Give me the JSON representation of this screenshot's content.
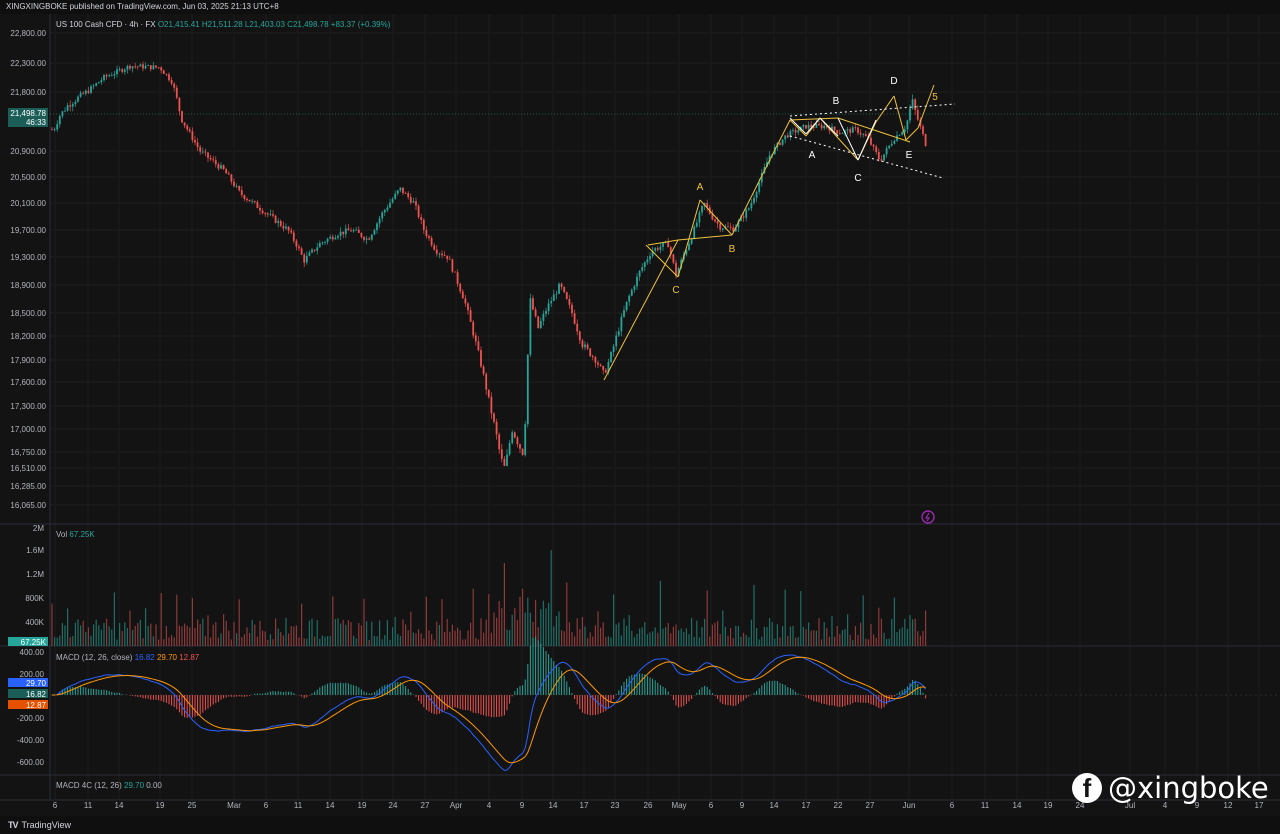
{
  "header": {
    "publisher": "XINGXINGBOKE published on TradingView.com, Jun 03, 2025 21:13 UTC+8"
  },
  "legend": {
    "main": {
      "symbol": "US 100 Cash CFD · 4h · FX",
      "open": "O21,415.41",
      "high": "H21,511.28",
      "low": "L21,403.03",
      "close": "C21,498.78",
      "change": "+83.37 (+0.39%)"
    },
    "volume": {
      "label": "Vol",
      "value": "67.25K"
    },
    "macd": {
      "label": "MACD (12, 26, close)",
      "v1": "16.82",
      "v2": "29.70",
      "v3": "12.87"
    },
    "macd4c": {
      "label": "MACD 4C (12, 26)",
      "v1": "29.70",
      "v2": "0.00"
    }
  },
  "footer": {
    "brand": "TradingView",
    "watermark": "@xingboke",
    "watermark_icon": "facebook-icon"
  },
  "colors": {
    "up": "#26a69a",
    "down": "#ef5350",
    "wave": "#f0c23b",
    "macd": "#2962ff",
    "signal": "#ff9800",
    "bg": "#131313"
  },
  "chart_data": {
    "type": "candlestick",
    "price_axis": {
      "ticks": [
        "22,800.00",
        "22,300.00",
        "21,800.00",
        "21,498.78",
        "20,900.00",
        "20,500.00",
        "20,100.00",
        "19,700.00",
        "19,300.00",
        "18,900.00",
        "18,500.00",
        "18,200.00",
        "17,900.00",
        "17,600.00",
        "17,300.00",
        "17,000.00",
        "16,750.00",
        "16,510.00",
        "16,285.00",
        "16,065.00"
      ],
      "current_price": "21,498.78",
      "countdown": "46:33",
      "ylim": [
        16065,
        22800
      ]
    },
    "time_axis": {
      "labels": [
        "6",
        "11",
        "14",
        "19",
        "25",
        "Mar",
        "6",
        "11",
        "14",
        "19",
        "24",
        "27",
        "Apr",
        "4",
        "9",
        "14",
        "17",
        "23",
        "26",
        "May",
        "6",
        "9",
        "14",
        "17",
        "22",
        "27",
        "Jun",
        "6",
        "11",
        "14",
        "19",
        "24",
        "Jul",
        "4",
        "9",
        "12",
        "17"
      ]
    },
    "price_path": [
      [
        "Feb 6",
        21250
      ],
      [
        "Feb 8",
        21480
      ],
      [
        "Feb 11",
        21620
      ],
      [
        "Feb 14",
        21820
      ],
      [
        "Feb 17",
        22050
      ],
      [
        "Feb 19",
        22250
      ],
      [
        "Feb 20",
        22222
      ],
      [
        "Feb 21",
        21980
      ],
      [
        "Feb 24",
        21400
      ],
      [
        "Feb 27",
        20900
      ],
      [
        "Mar 3",
        20600
      ],
      [
        "Mar 6",
        20250
      ],
      [
        "Mar 10",
        19700
      ],
      [
        "Mar 11",
        19500
      ],
      [
        "Mar 13",
        19250
      ],
      [
        "Mar 14",
        19500
      ],
      [
        "Mar 17",
        19650
      ],
      [
        "Mar 19",
        19700
      ],
      [
        "Mar 21",
        19560
      ],
      [
        "Mar 24",
        19940
      ],
      [
        "Mar 26",
        20320
      ],
      [
        "Mar 27",
        20100
      ],
      [
        "Mar 28",
        19700
      ],
      [
        "Mar 31",
        19400
      ],
      [
        "Apr 2",
        19300
      ],
      [
        "Apr 3",
        18700
      ],
      [
        "Apr 4",
        17900
      ],
      [
        "Apr 6",
        17300
      ],
      [
        "Apr 7",
        16500
      ],
      [
        "Apr 8",
        17000
      ],
      [
        "Apr 9",
        16700
      ],
      [
        "Apr 9b",
        18700
      ],
      [
        "Apr 10",
        18300
      ],
      [
        "Apr 11",
        18600
      ],
      [
        "Apr 13",
        18900
      ],
      [
        "Apr 14",
        18500
      ],
      [
        "Apr 16",
        18100
      ],
      [
        "Apr 18",
        17900
      ],
      [
        "Apr 21",
        17700
      ],
      [
        "Apr 22",
        18000
      ],
      [
        "Apr 23",
        18700
      ],
      [
        "Apr 24",
        19100
      ],
      [
        "Apr 25",
        19400
      ],
      [
        "Apr 28",
        19500
      ],
      [
        "Apr 30",
        19050
      ],
      [
        "May 1",
        19700
      ],
      [
        "May 2",
        20100
      ],
      [
        "May 5",
        19900
      ],
      [
        "May 6",
        19750
      ],
      [
        "May 7",
        19720
      ],
      [
        "May 8",
        20050
      ],
      [
        "May 12",
        20850
      ],
      [
        "May 13",
        21150
      ],
      [
        "May 14",
        21300
      ],
      [
        "May 16",
        21300
      ],
      [
        "May 19",
        21200
      ],
      [
        "May 21",
        21250
      ],
      [
        "May 22",
        21100
      ],
      [
        "May 23",
        20750
      ],
      [
        "May 27",
        21100
      ],
      [
        "May 28",
        21300
      ],
      [
        "May 29",
        21700
      ],
      [
        "May 30",
        21000
      ],
      [
        "Jun 2",
        21000
      ],
      [
        "Jun 3",
        21499
      ]
    ],
    "volume": {
      "axis_ticks": [
        "2M",
        "1.6M",
        "1.2M",
        "800K",
        "400K"
      ],
      "last": "67.25K"
    },
    "macd_axis": {
      "ticks": [
        "400.00",
        "200.00",
        "29.70",
        "16.82",
        "12.87",
        "-200.00",
        "-400.00",
        "-600.00"
      ]
    },
    "annotations": [
      {
        "text": "A",
        "color": "yellow"
      },
      {
        "text": "B",
        "color": "yellow"
      },
      {
        "text": "C",
        "color": "yellow"
      },
      {
        "text": "A",
        "color": "white"
      },
      {
        "text": "B",
        "color": "white"
      },
      {
        "text": "C",
        "color": "white"
      },
      {
        "text": "D",
        "color": "white"
      },
      {
        "text": "E",
        "color": "white"
      },
      {
        "text": "5",
        "color": "yellow"
      }
    ]
  }
}
